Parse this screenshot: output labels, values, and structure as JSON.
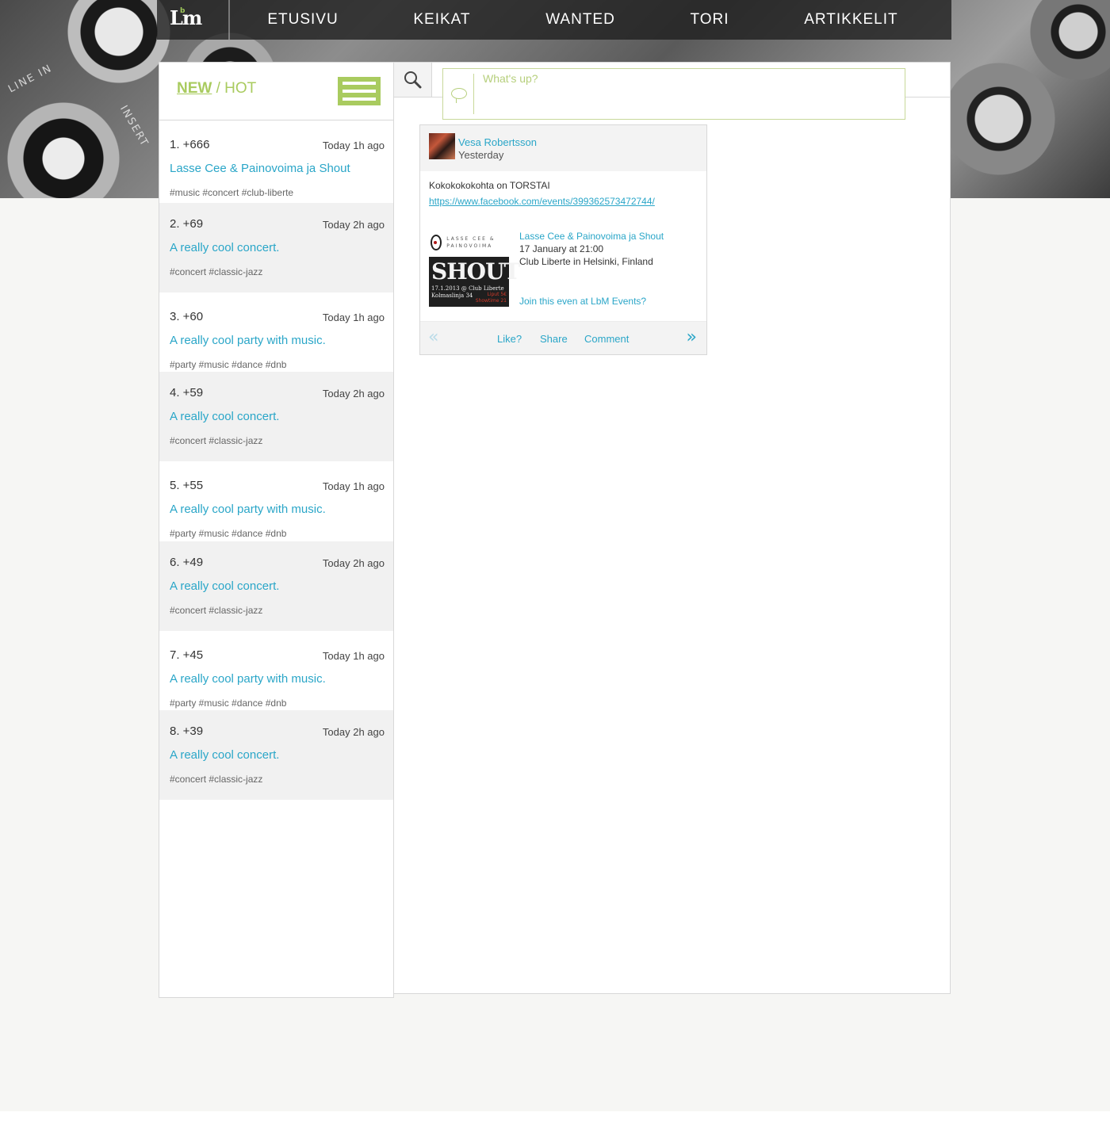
{
  "colors": {
    "accent_green": "#a9cb5f",
    "link_blue": "#2aa6c8",
    "panel_border": "#d8d8d8",
    "alt_row": "#f1f1f1"
  },
  "nav": {
    "logo_text": "Lm",
    "logo_sup": "b",
    "items": [
      "ETUSIVU",
      "KEIKAT",
      "WANTED",
      "TORI",
      "ARTIKKELIT"
    ]
  },
  "hero": {
    "labels": [
      "LINE IN",
      "INSERT"
    ]
  },
  "feed": {
    "filter_new": "NEW",
    "filter_sep": " / ",
    "filter_hot": "HOT",
    "menu_icon": "hamburger-menu-icon",
    "items": [
      {
        "rank": "1. +666",
        "time": "Today 1h ago",
        "title": "Lasse Cee & Painovoima ja Shout",
        "tags": "#music #concert #club-liberte"
      },
      {
        "rank": "2. +69",
        "time": "Today 2h ago",
        "title": "A really cool concert.",
        "tags": "#concert #classic-jazz"
      },
      {
        "rank": "3. +60",
        "time": "Today 1h ago",
        "title": "A really cool party with music.",
        "tags": "#party #music #dance #dnb"
      },
      {
        "rank": "4. +59",
        "time": "Today 2h ago",
        "title": "A really cool concert.",
        "tags": "#concert #classic-jazz"
      },
      {
        "rank": "5. +55",
        "time": "Today 1h ago",
        "title": "A really cool party with music.",
        "tags": "#party #music #dance #dnb"
      },
      {
        "rank": "6. +49",
        "time": "Today 2h ago",
        "title": "A really cool concert.",
        "tags": "#concert #classic-jazz"
      },
      {
        "rank": "7. +45",
        "time": "Today 1h ago",
        "title": "A really cool party with music.",
        "tags": "#party #music #dance #dnb"
      },
      {
        "rank": "8. +39",
        "time": "Today 2h ago",
        "title": "A really cool concert.",
        "tags": "#concert #classic-jazz"
      }
    ]
  },
  "status": {
    "placeholder": "What's up?",
    "search_icon": "magnifier-icon",
    "bubble_icon": "speech-bubble-icon"
  },
  "post": {
    "author": "Vesa Robertsson",
    "when": "Yesterday",
    "text": "Kokokokokohta on TORSTAI",
    "link": "https://www.facebook.com/events/399362573472744/",
    "event": {
      "thumb_top": "LASSE CEE & PAINOVOIMA",
      "thumb_title": "SHOUT",
      "thumb_line1": "17.1.2013 @ Club Liberte",
      "thumb_line2": "Kolmaslinja 34",
      "thumb_red1": "Liput 5€",
      "thumb_red2": "Showtime 21",
      "title": "Lasse Cee & Painovoima ja Shout",
      "date": "17 January at 21:00",
      "place": "Club Liberte in Helsinki, Finland",
      "join": "Join this even at LbM Events?"
    },
    "actions": {
      "prev": "«",
      "like": "Like?",
      "share": "Share",
      "comment": "Comment",
      "next": "»"
    }
  }
}
